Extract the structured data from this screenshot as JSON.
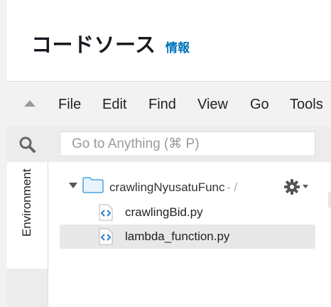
{
  "page": {
    "title": "コードソース",
    "info_link": "情報"
  },
  "menubar": {
    "items": [
      "File",
      "Edit",
      "Find",
      "View",
      "Go",
      "Tools"
    ]
  },
  "search": {
    "placeholder": "Go to Anything (⌘ P)"
  },
  "sidebar": {
    "tab_label": "Environment"
  },
  "tree": {
    "root": {
      "label": "crawlingNyusatuFunc",
      "suffix": "- /"
    },
    "files": [
      {
        "label": "crawlingBid.py",
        "selected": false
      },
      {
        "label": "lambda_function.py",
        "selected": true
      }
    ]
  },
  "colors": {
    "accent_link": "#0073bb",
    "folder": "#4aa3df",
    "file_icon": "#2a7fd4",
    "selected_row": "#e8e8e8"
  },
  "icons": {
    "collapse": "triangle-up-icon",
    "search": "search-icon",
    "folder": "folder-icon",
    "settings": "gear-icon",
    "file": "code-file-icon"
  }
}
